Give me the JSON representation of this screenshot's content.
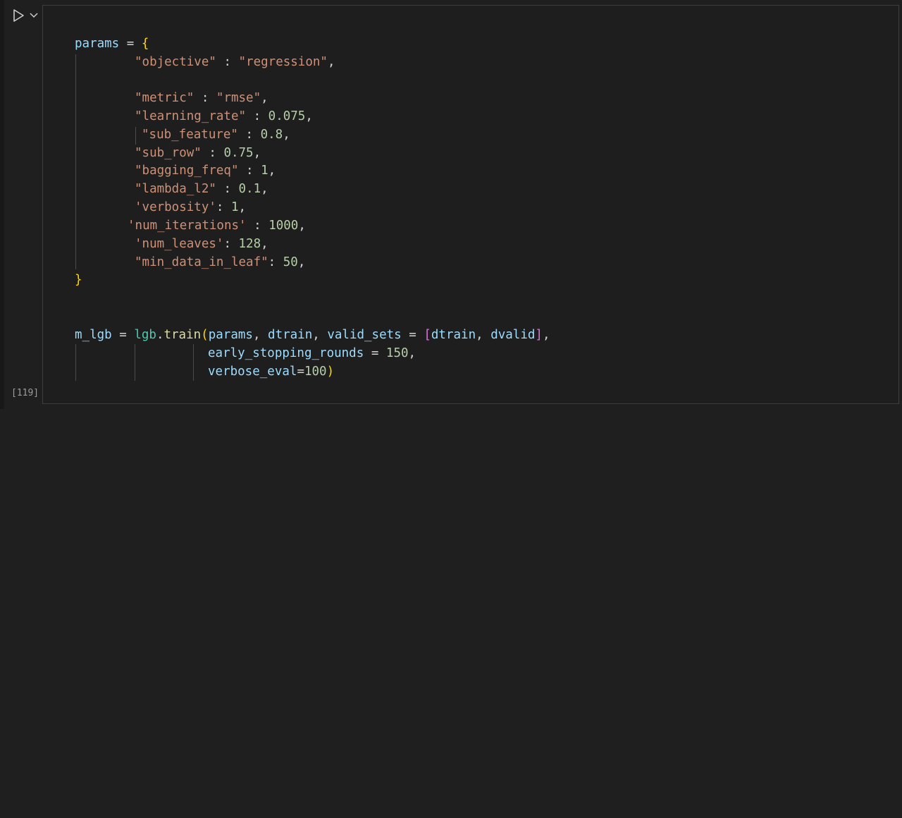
{
  "cell": {
    "execution_count": "[119]",
    "run_icon": "play-icon",
    "chevron_icon": "chevron-down-icon"
  },
  "code": {
    "params_assign": "params",
    "eq": "=",
    "open_brace": "{",
    "close_brace": "}",
    "colon": ":",
    "comma": ",",
    "pairs": [
      {
        "key": "\"objective\"",
        "sep": " : ",
        "val": "\"regression\"",
        "val_type": "str"
      },
      {
        "key": "\"metric\"",
        "sep": " : ",
        "val": "\"rmse\"",
        "val_type": "str"
      },
      {
        "key": "\"learning_rate\"",
        "sep": " : ",
        "val": "0.075",
        "val_type": "num"
      },
      {
        "key": "\"sub_feature\"",
        "sep": " : ",
        "val": "0.8",
        "val_type": "num"
      },
      {
        "key": "\"sub_row\"",
        "sep": " : ",
        "val": "0.75",
        "val_type": "num"
      },
      {
        "key": "\"bagging_freq\"",
        "sep": " : ",
        "val": "1",
        "val_type": "num"
      },
      {
        "key": "\"lambda_l2\"",
        "sep": " : ",
        "val": "0.1",
        "val_type": "num"
      },
      {
        "key": "'verbosity'",
        "sep": ": ",
        "val": "1",
        "val_type": "num"
      },
      {
        "key": "'num_iterations'",
        "sep": " : ",
        "val": "1000",
        "val_type": "num"
      },
      {
        "key": "'num_leaves'",
        "sep": ": ",
        "val": "128",
        "val_type": "num"
      },
      {
        "key": "\"min_data_in_leaf\"",
        "sep": ": ",
        "val": "50",
        "val_type": "num"
      }
    ],
    "train_var": "m_lgb",
    "module": "lgb",
    "dot": ".",
    "func": "train",
    "open_paren": "(",
    "close_paren": ")",
    "arg_params": "params",
    "arg_dtrain": "dtrain",
    "kw_valid_sets": "valid_sets",
    "open_bracket": "[",
    "close_bracket": "]",
    "list_dtrain": "dtrain",
    "list_dvalid": "dvalid",
    "kw_early": "early_stopping_rounds",
    "val_early": "150",
    "kw_verbose": "verbose_eval",
    "val_verbose": "100"
  }
}
